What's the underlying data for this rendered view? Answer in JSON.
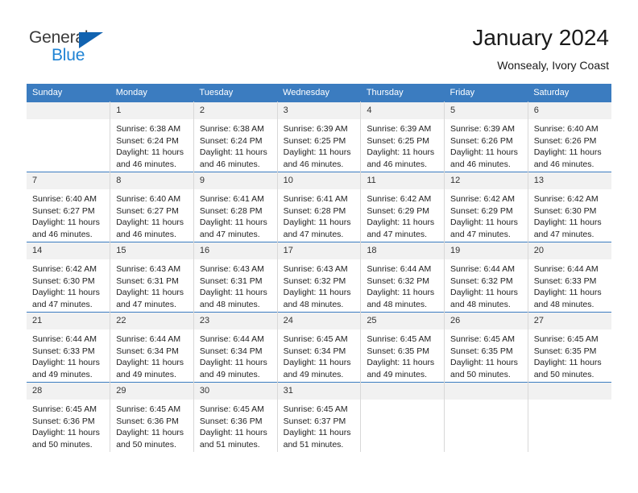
{
  "brand": {
    "name_top": "General",
    "name_bottom": "Blue",
    "triangle_color": "#1263b0",
    "blue_color": "#1f83d4",
    "gray_color": "#3b3b3b"
  },
  "header": {
    "title": "January 2024",
    "subtitle": "Wonsealy, Ivory Coast",
    "header_bg": "#3b7cc0",
    "header_text": "#ffffff",
    "daynum_bg": "#f1f1f1"
  },
  "weekday_headers": [
    "Sunday",
    "Monday",
    "Tuesday",
    "Wednesday",
    "Thursday",
    "Friday",
    "Saturday"
  ],
  "weeks": [
    [
      {
        "day": "",
        "sunrise": "",
        "sunset": "",
        "daylight1": "",
        "daylight2": ""
      },
      {
        "day": "1",
        "sunrise": "Sunrise: 6:38 AM",
        "sunset": "Sunset: 6:24 PM",
        "daylight1": "Daylight: 11 hours",
        "daylight2": "and 46 minutes."
      },
      {
        "day": "2",
        "sunrise": "Sunrise: 6:38 AM",
        "sunset": "Sunset: 6:24 PM",
        "daylight1": "Daylight: 11 hours",
        "daylight2": "and 46 minutes."
      },
      {
        "day": "3",
        "sunrise": "Sunrise: 6:39 AM",
        "sunset": "Sunset: 6:25 PM",
        "daylight1": "Daylight: 11 hours",
        "daylight2": "and 46 minutes."
      },
      {
        "day": "4",
        "sunrise": "Sunrise: 6:39 AM",
        "sunset": "Sunset: 6:25 PM",
        "daylight1": "Daylight: 11 hours",
        "daylight2": "and 46 minutes."
      },
      {
        "day": "5",
        "sunrise": "Sunrise: 6:39 AM",
        "sunset": "Sunset: 6:26 PM",
        "daylight1": "Daylight: 11 hours",
        "daylight2": "and 46 minutes."
      },
      {
        "day": "6",
        "sunrise": "Sunrise: 6:40 AM",
        "sunset": "Sunset: 6:26 PM",
        "daylight1": "Daylight: 11 hours",
        "daylight2": "and 46 minutes."
      }
    ],
    [
      {
        "day": "7",
        "sunrise": "Sunrise: 6:40 AM",
        "sunset": "Sunset: 6:27 PM",
        "daylight1": "Daylight: 11 hours",
        "daylight2": "and 46 minutes."
      },
      {
        "day": "8",
        "sunrise": "Sunrise: 6:40 AM",
        "sunset": "Sunset: 6:27 PM",
        "daylight1": "Daylight: 11 hours",
        "daylight2": "and 46 minutes."
      },
      {
        "day": "9",
        "sunrise": "Sunrise: 6:41 AM",
        "sunset": "Sunset: 6:28 PM",
        "daylight1": "Daylight: 11 hours",
        "daylight2": "and 47 minutes."
      },
      {
        "day": "10",
        "sunrise": "Sunrise: 6:41 AM",
        "sunset": "Sunset: 6:28 PM",
        "daylight1": "Daylight: 11 hours",
        "daylight2": "and 47 minutes."
      },
      {
        "day": "11",
        "sunrise": "Sunrise: 6:42 AM",
        "sunset": "Sunset: 6:29 PM",
        "daylight1": "Daylight: 11 hours",
        "daylight2": "and 47 minutes."
      },
      {
        "day": "12",
        "sunrise": "Sunrise: 6:42 AM",
        "sunset": "Sunset: 6:29 PM",
        "daylight1": "Daylight: 11 hours",
        "daylight2": "and 47 minutes."
      },
      {
        "day": "13",
        "sunrise": "Sunrise: 6:42 AM",
        "sunset": "Sunset: 6:30 PM",
        "daylight1": "Daylight: 11 hours",
        "daylight2": "and 47 minutes."
      }
    ],
    [
      {
        "day": "14",
        "sunrise": "Sunrise: 6:42 AM",
        "sunset": "Sunset: 6:30 PM",
        "daylight1": "Daylight: 11 hours",
        "daylight2": "and 47 minutes."
      },
      {
        "day": "15",
        "sunrise": "Sunrise: 6:43 AM",
        "sunset": "Sunset: 6:31 PM",
        "daylight1": "Daylight: 11 hours",
        "daylight2": "and 47 minutes."
      },
      {
        "day": "16",
        "sunrise": "Sunrise: 6:43 AM",
        "sunset": "Sunset: 6:31 PM",
        "daylight1": "Daylight: 11 hours",
        "daylight2": "and 48 minutes."
      },
      {
        "day": "17",
        "sunrise": "Sunrise: 6:43 AM",
        "sunset": "Sunset: 6:32 PM",
        "daylight1": "Daylight: 11 hours",
        "daylight2": "and 48 minutes."
      },
      {
        "day": "18",
        "sunrise": "Sunrise: 6:44 AM",
        "sunset": "Sunset: 6:32 PM",
        "daylight1": "Daylight: 11 hours",
        "daylight2": "and 48 minutes."
      },
      {
        "day": "19",
        "sunrise": "Sunrise: 6:44 AM",
        "sunset": "Sunset: 6:32 PM",
        "daylight1": "Daylight: 11 hours",
        "daylight2": "and 48 minutes."
      },
      {
        "day": "20",
        "sunrise": "Sunrise: 6:44 AM",
        "sunset": "Sunset: 6:33 PM",
        "daylight1": "Daylight: 11 hours",
        "daylight2": "and 48 minutes."
      }
    ],
    [
      {
        "day": "21",
        "sunrise": "Sunrise: 6:44 AM",
        "sunset": "Sunset: 6:33 PM",
        "daylight1": "Daylight: 11 hours",
        "daylight2": "and 49 minutes."
      },
      {
        "day": "22",
        "sunrise": "Sunrise: 6:44 AM",
        "sunset": "Sunset: 6:34 PM",
        "daylight1": "Daylight: 11 hours",
        "daylight2": "and 49 minutes."
      },
      {
        "day": "23",
        "sunrise": "Sunrise: 6:44 AM",
        "sunset": "Sunset: 6:34 PM",
        "daylight1": "Daylight: 11 hours",
        "daylight2": "and 49 minutes."
      },
      {
        "day": "24",
        "sunrise": "Sunrise: 6:45 AM",
        "sunset": "Sunset: 6:34 PM",
        "daylight1": "Daylight: 11 hours",
        "daylight2": "and 49 minutes."
      },
      {
        "day": "25",
        "sunrise": "Sunrise: 6:45 AM",
        "sunset": "Sunset: 6:35 PM",
        "daylight1": "Daylight: 11 hours",
        "daylight2": "and 49 minutes."
      },
      {
        "day": "26",
        "sunrise": "Sunrise: 6:45 AM",
        "sunset": "Sunset: 6:35 PM",
        "daylight1": "Daylight: 11 hours",
        "daylight2": "and 50 minutes."
      },
      {
        "day": "27",
        "sunrise": "Sunrise: 6:45 AM",
        "sunset": "Sunset: 6:35 PM",
        "daylight1": "Daylight: 11 hours",
        "daylight2": "and 50 minutes."
      }
    ],
    [
      {
        "day": "28",
        "sunrise": "Sunrise: 6:45 AM",
        "sunset": "Sunset: 6:36 PM",
        "daylight1": "Daylight: 11 hours",
        "daylight2": "and 50 minutes."
      },
      {
        "day": "29",
        "sunrise": "Sunrise: 6:45 AM",
        "sunset": "Sunset: 6:36 PM",
        "daylight1": "Daylight: 11 hours",
        "daylight2": "and 50 minutes."
      },
      {
        "day": "30",
        "sunrise": "Sunrise: 6:45 AM",
        "sunset": "Sunset: 6:36 PM",
        "daylight1": "Daylight: 11 hours",
        "daylight2": "and 51 minutes."
      },
      {
        "day": "31",
        "sunrise": "Sunrise: 6:45 AM",
        "sunset": "Sunset: 6:37 PM",
        "daylight1": "Daylight: 11 hours",
        "daylight2": "and 51 minutes."
      },
      {
        "day": "",
        "sunrise": "",
        "sunset": "",
        "daylight1": "",
        "daylight2": ""
      },
      {
        "day": "",
        "sunrise": "",
        "sunset": "",
        "daylight1": "",
        "daylight2": ""
      },
      {
        "day": "",
        "sunrise": "",
        "sunset": "",
        "daylight1": "",
        "daylight2": ""
      }
    ]
  ]
}
